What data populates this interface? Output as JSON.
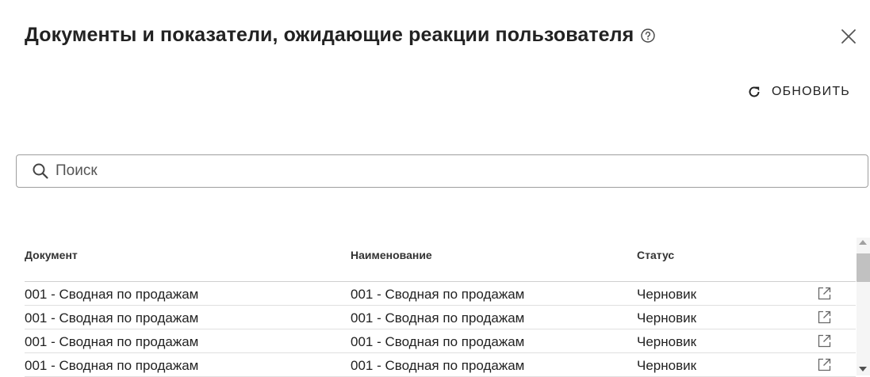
{
  "dialog": {
    "title": "Документы и показатели, ожидающие реакции пользователя",
    "refresh_label": "ОБНОВИТЬ"
  },
  "search": {
    "placeholder": "Поиск",
    "value": ""
  },
  "table": {
    "headers": {
      "document": "Документ",
      "name": "Наименование",
      "status": "Статус"
    },
    "rows": [
      {
        "document": "001 - Сводная по продажам",
        "name": "001 - Сводная по продажам",
        "status": "Черновик"
      },
      {
        "document": "001 - Сводная по продажам",
        "name": "001 - Сводная по продажам",
        "status": "Черновик"
      },
      {
        "document": "001 - Сводная по продажам",
        "name": "001 - Сводная по продажам",
        "status": "Черновик"
      },
      {
        "document": "001 - Сводная по продажам",
        "name": "001 - Сводная по продажам",
        "status": "Черновик"
      }
    ]
  },
  "icons": {
    "help": "help-circle-icon",
    "close": "close-icon",
    "refresh": "refresh-icon",
    "search": "search-icon",
    "open": "open-in-new-icon"
  }
}
